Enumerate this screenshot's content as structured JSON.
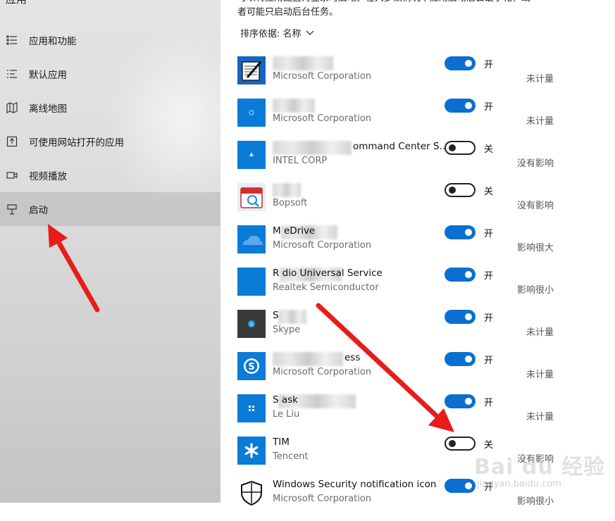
{
  "sidebar": {
    "title": "应用",
    "items": [
      {
        "label": "应用和功能",
        "icon": "apps-list-icon"
      },
      {
        "label": "默认应用",
        "icon": "default-apps-icon"
      },
      {
        "label": "离线地图",
        "icon": "offline-maps-icon"
      },
      {
        "label": "可使用网站打开的应用",
        "icon": "open-with-website-icon"
      },
      {
        "label": "视频播放",
        "icon": "video-playback-icon"
      },
      {
        "label": "启动",
        "icon": "startup-icon",
        "active": true
      }
    ]
  },
  "main": {
    "intro_line1": "可以将应用配置为登录时启动。在大多数情况下应用启动后会最小化，或",
    "intro_line2": "者可能只启动后台任务。",
    "sort": {
      "label": "排序依据:",
      "value": "名称"
    },
    "apps": [
      {
        "name": "",
        "publisher": "Microsoft Corporation",
        "state": "开",
        "on": true,
        "impact": "未计量",
        "icon": "notepad-icon"
      },
      {
        "name": "",
        "publisher": "Microsoft Corporation",
        "state": "开",
        "on": true,
        "impact": "未计量",
        "icon": "blue-app-icon"
      },
      {
        "name": "ommand Center S...",
        "publisher": "INTEL CORP",
        "state": "关",
        "on": false,
        "impact": "没有影响",
        "icon": "intel-icon"
      },
      {
        "name": "",
        "publisher": "Bopsoft",
        "state": "关",
        "on": false,
        "impact": "没有影响",
        "icon": "calendar-icon"
      },
      {
        "name": "M                eDrive",
        "publisher": "Microsoft Corporation",
        "state": "开",
        "on": true,
        "impact": "影响很大",
        "icon": "onedrive-icon"
      },
      {
        "name": "R                 dio Universal Service",
        "publisher": "Realtek Semiconductor",
        "state": "开",
        "on": true,
        "impact": "影响很小",
        "icon": "realtek-icon"
      },
      {
        "name": "S",
        "publisher": "Skype",
        "state": "开",
        "on": true,
        "impact": "未计量",
        "icon": "skype-small-icon"
      },
      {
        "name": "ess",
        "publisher": "Microsoft Corporation",
        "state": "开",
        "on": true,
        "impact": "未计量",
        "icon": "skype-icon"
      },
      {
        "name": "S                    ask",
        "publisher": "Le Liu",
        "state": "开",
        "on": true,
        "impact": "未计量",
        "icon": "task-icon"
      },
      {
        "name": "TIM",
        "publisher": "Tencent",
        "state": "关",
        "on": false,
        "impact": "没有影响",
        "icon": "tim-icon"
      },
      {
        "name": "Windows Security notification icon",
        "publisher": "Microsoft Corporation",
        "state": "开",
        "on": true,
        "impact": "影响很小",
        "icon": "shield-icon"
      }
    ]
  },
  "watermark": {
    "text": "Bai du 经验",
    "url": "jingyan.baidu.com"
  },
  "colors": {
    "accent": "#0a6fd1",
    "arrow": "#e81c1c"
  }
}
